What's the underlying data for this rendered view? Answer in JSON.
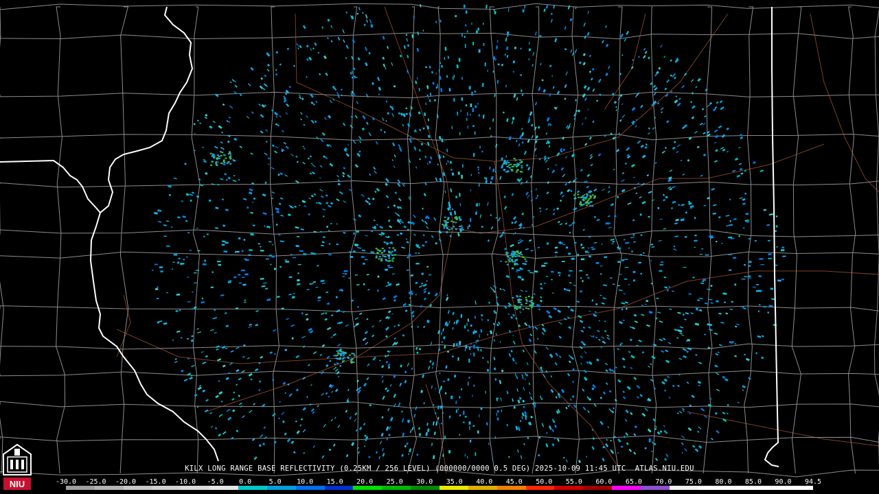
{
  "caption": "KILX LONG RANGE BASE REFLECTIVITY (0.25KM / 256 LEVEL) (000000/0000 0.5 DEG) 2025-10-09 11:45 UTC  ATLAS.NIU.EDU",
  "scale": {
    "labels": [
      "-30.0",
      "-25.0",
      "-20.0",
      "-15.0",
      "-10.0",
      "-5.0",
      "0.0",
      "5.0",
      "10.0",
      "15.0",
      "20.0",
      "25.0",
      "30.0",
      "35.0",
      "40.0",
      "45.0",
      "50.0",
      "55.0",
      "60.0",
      "65.0",
      "70.0",
      "75.0",
      "80.0",
      "85.0",
      "90.0",
      "94.5"
    ],
    "colors": [
      "#a0a0a0",
      "#b4b4b4",
      "#c8c8c8",
      "#d2d2d2",
      "#dcdcdc",
      "#e6e6e6",
      "#00c8c8",
      "#00a0e0",
      "#0070f0",
      "#0030d0",
      "#00e000",
      "#00b800",
      "#008a00",
      "#e8e800",
      "#e0b000",
      "#f08000",
      "#ff2800",
      "#d00000",
      "#a00000",
      "#ff00ff",
      "#9050d0",
      "#f0f0f0",
      "#ffffff",
      "#ffffff",
      "#ffffff",
      "#ffffff"
    ]
  },
  "logo": {
    "text": "NIU",
    "color": "#c8102e"
  },
  "colors": {
    "background": "#000000",
    "county_lines": "#8c8c8c",
    "state_lines": "#ffffff",
    "roads": "#8a4a2a"
  }
}
